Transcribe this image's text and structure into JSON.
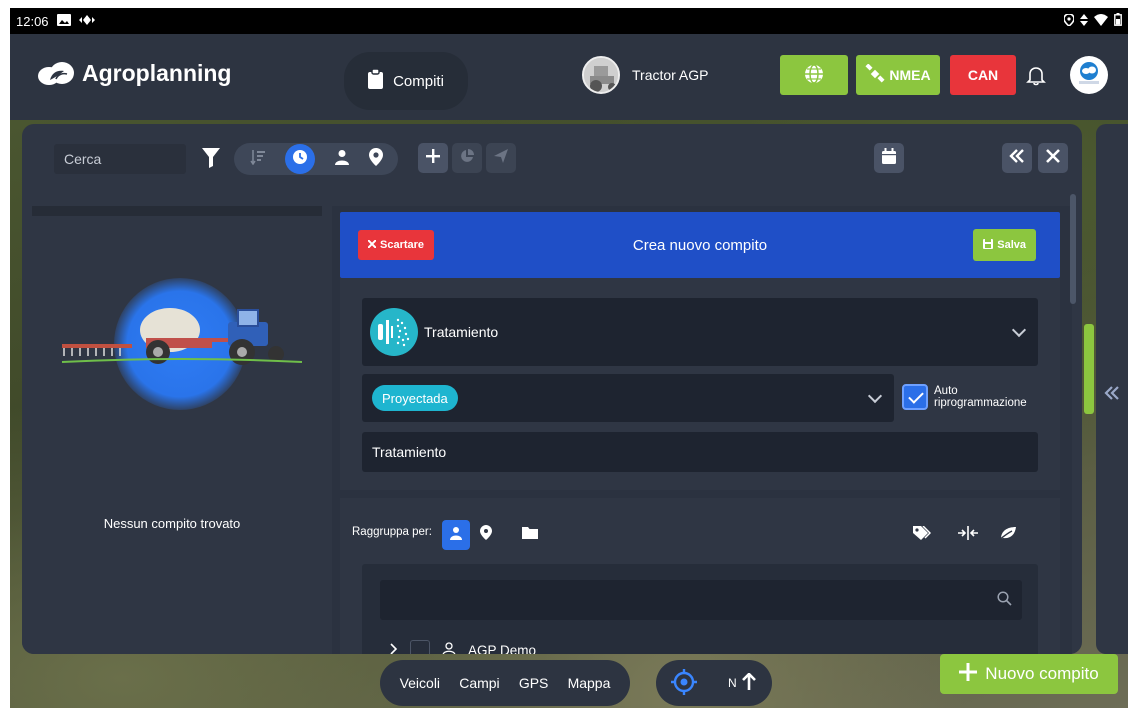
{
  "status_bar": {
    "time": "12:06",
    "icons": [
      "image-icon",
      "diamond-icon",
      "location-icon",
      "sort-icon",
      "wifi-icon",
      "battery-icon"
    ]
  },
  "app": {
    "brand": "Agroplanning"
  },
  "header": {
    "tab_label": "Compiti",
    "vehicle_name": "Tractor AGP",
    "nmea_label": "NMEA",
    "can_label": "CAN",
    "colors": {
      "green": "#8cc63f",
      "red": "#e8353b"
    }
  },
  "toolbar": {
    "search_placeholder": "Cerca"
  },
  "left_panel": {
    "empty_message": "Nessun compito trovato"
  },
  "form": {
    "discard_label": "Scartare",
    "title": "Crea nuovo compito",
    "save_label": "Salva",
    "operation_label": "Tratamiento",
    "status_label": "Proyectada",
    "auto_label_line1": "Auto",
    "auto_label_line2": "riprogrammazione",
    "auto_checked": true,
    "name_value": "Tratamiento"
  },
  "grouping": {
    "label": "Raggruppa per:",
    "tree_items": [
      {
        "label": "AGP Demo"
      }
    ]
  },
  "bottom_nav": {
    "items": [
      "Veicoli",
      "Campi",
      "GPS",
      "Mappa"
    ],
    "north_label": "N"
  },
  "new_task_button": "Nuovo compito"
}
